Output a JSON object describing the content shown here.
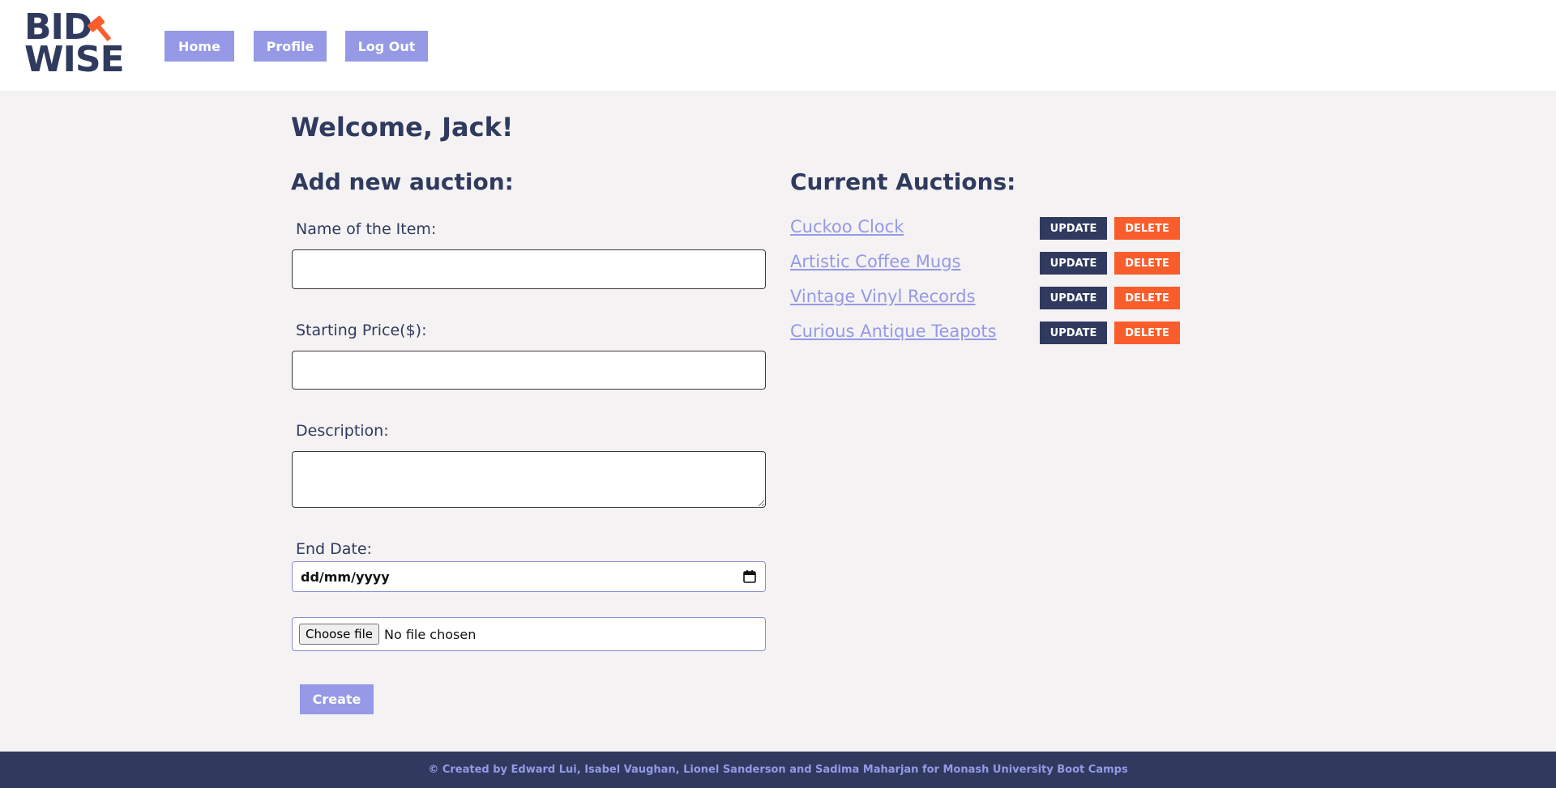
{
  "logo": {
    "line1": "BID",
    "line2": "WISE",
    "icon": "gavel-icon"
  },
  "nav": {
    "home": "Home",
    "profile": "Profile",
    "logout": "Log Out"
  },
  "welcome": "Welcome, Jack!",
  "form": {
    "title": "Add new auction:",
    "name_label": "Name of the Item:",
    "name_value": "",
    "price_label": "Starting Price($):",
    "price_value": "",
    "description_label": "Description:",
    "description_value": "",
    "end_date_label": "End Date:",
    "end_date_placeholder": "dd/mm/yyyy",
    "file_button": "Choose file",
    "file_status": "No file chosen",
    "create_label": "Create"
  },
  "auctions": {
    "title": "Current Auctions:",
    "update_label": "UPDATE",
    "delete_label": "DELETE",
    "items": [
      {
        "name": "Cuckoo Clock"
      },
      {
        "name": "Artistic Coffee Mugs"
      },
      {
        "name": "Vintage Vinyl Records"
      },
      {
        "name": "Curious Antique Teapots"
      }
    ]
  },
  "footer": "© Created by Edward Lui, Isabel Vaughan, Lionel Sanderson and Sadima Maharjan for Monash University Boot Camps",
  "colors": {
    "navy": "#2f3a5e",
    "lavender": "#9599e6",
    "orange": "#fa5d2c",
    "background": "#f4f2f3"
  }
}
